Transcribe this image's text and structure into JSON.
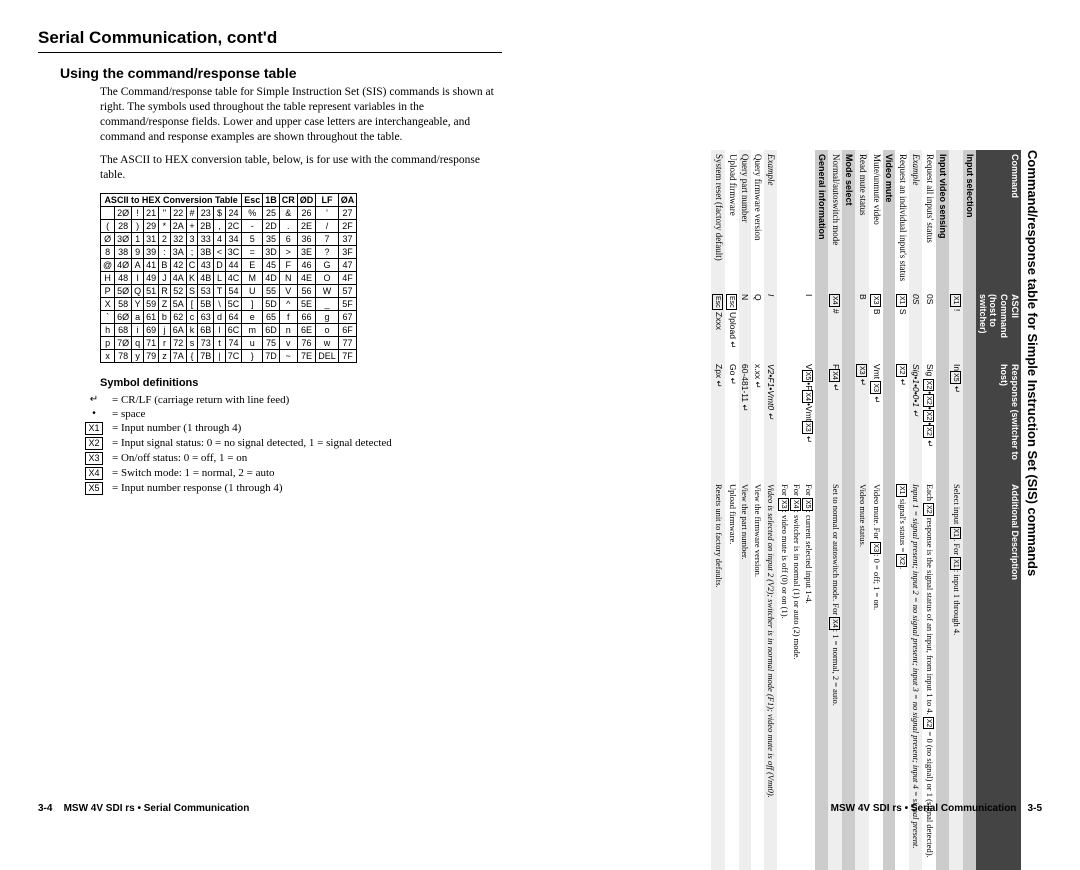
{
  "left": {
    "section_title": "Serial Communication, cont'd",
    "subheading": "Using the command/response table",
    "para1": "The Command/response table for Simple Instruction Set (SIS) commands is shown at right.  The symbols used throughout the table represent variables in the command/response fields.  Lower and upper case letters are interchangeable, and command and response examples are shown throughout the table.",
    "para2": "The ASCII to HEX conversion table, below, is for use with the command/response table.",
    "hex_title": "ASCII to HEX  Conversion Table",
    "hex_extra": [
      "Esc",
      "1B",
      "CR",
      "ØD",
      "LF",
      "ØA"
    ],
    "hex_rows": [
      [
        " ",
        "2Ø",
        "!",
        "21",
        "\"",
        "22",
        "#",
        "23",
        "$",
        "24",
        "%",
        "25",
        "&",
        "26",
        "'",
        "27"
      ],
      [
        "(",
        "28",
        ")",
        "29",
        "*",
        "2A",
        "+",
        "2B",
        ",",
        "2C",
        "-",
        "2D",
        ".",
        "2E",
        "/",
        "2F"
      ],
      [
        "Ø",
        "3Ø",
        "1",
        "31",
        "2",
        "32",
        "3",
        "33",
        "4",
        "34",
        "5",
        "35",
        "6",
        "36",
        "7",
        "37"
      ],
      [
        "8",
        "38",
        "9",
        "39",
        ":",
        "3A",
        ";",
        "3B",
        "<",
        "3C",
        "=",
        "3D",
        ">",
        "3E",
        "?",
        "3F"
      ],
      [
        "@",
        "4Ø",
        "A",
        "41",
        "B",
        "42",
        "C",
        "43",
        "D",
        "44",
        "E",
        "45",
        "F",
        "46",
        "G",
        "47"
      ],
      [
        "H",
        "48",
        "I",
        "49",
        "J",
        "4A",
        "K",
        "4B",
        "L",
        "4C",
        "M",
        "4D",
        "N",
        "4E",
        "O",
        "4F"
      ],
      [
        "P",
        "5Ø",
        "Q",
        "51",
        "R",
        "52",
        "S",
        "53",
        "T",
        "54",
        "U",
        "55",
        "V",
        "56",
        "W",
        "57"
      ],
      [
        "X",
        "58",
        "Y",
        "59",
        "Z",
        "5A",
        "[",
        "5B",
        "\\",
        "5C",
        "]",
        "5D",
        "^",
        "5E",
        "_",
        "5F"
      ],
      [
        "`",
        "6Ø",
        "a",
        "61",
        "b",
        "62",
        "c",
        "63",
        "d",
        "64",
        "e",
        "65",
        "f",
        "66",
        "g",
        "67"
      ],
      [
        "h",
        "68",
        "i",
        "69",
        "j",
        "6A",
        "k",
        "6B",
        "l",
        "6C",
        "m",
        "6D",
        "n",
        "6E",
        "o",
        "6F"
      ],
      [
        "p",
        "7Ø",
        "q",
        "71",
        "r",
        "72",
        "s",
        "73",
        "t",
        "74",
        "u",
        "75",
        "v",
        "76",
        "w",
        "77"
      ],
      [
        "x",
        "78",
        "y",
        "79",
        "z",
        "7A",
        "{",
        "7B",
        "|",
        "7C",
        "}",
        "7D",
        "~",
        "7E",
        "DEL",
        "7F"
      ]
    ],
    "sym_title": "Symbol definitions",
    "symbols": [
      {
        "k": "↵",
        "d": "= CR/LF (carriage return with line feed)"
      },
      {
        "k": "•",
        "d": "= space"
      },
      {
        "k": "X1",
        "d": "= Input number (1 through 4)",
        "box": true
      },
      {
        "k": "X2",
        "d": "= Input signal status: 0 = no signal detected, 1 = signal detected",
        "box": true
      },
      {
        "k": "X3",
        "d": "= On/off status: 0 = off, 1 = on",
        "box": true
      },
      {
        "k": "X4",
        "d": "= Switch mode: 1 = normal, 2 = auto",
        "box": true
      },
      {
        "k": "X5",
        "d": "= Input number response (1 through 4)",
        "box": true
      }
    ],
    "footer_num": "3-4",
    "footer_txt": "MSW 4V SDI rs • Serial Communication"
  },
  "right": {
    "caption": "Command/response table for Simple Instruction Set (SIS) commands",
    "head": [
      "Command",
      "ASCII Command (host to switcher)",
      "Response (switcher to host)",
      "Additional Description"
    ],
    "rows": [
      {
        "type": "group",
        "label": "Input selection"
      },
      {
        "type": "row",
        "shade": true,
        "c": "",
        "a": "[X1] !",
        "r": "In[X5] ↵",
        "d": "Select input [X1]. For [X1]: input 1 through 4."
      },
      {
        "type": "group",
        "label": "Input video sensing"
      },
      {
        "type": "row",
        "c": "Request all inputs' status",
        "a": "0S",
        "r": "Sig [X2]•[X2]•[X2]•[X2] ↵",
        "d": "Each [X2] response is the signal status of an input, from input 1 to 4. [X2] = 0 (no signal) or 1 (signal detected)."
      },
      {
        "type": "row",
        "shade": true,
        "ital": true,
        "c": "Example",
        "a": "0S",
        "r": "Sig•1•0•0•1 ↵",
        "d": "Input 1 = signal present; input 2 = no signal present; input 3 = no signal present; input 4 = signal present."
      },
      {
        "type": "row",
        "c": "Request an individual input's status",
        "a": "[X1] S",
        "r": "[X2] ↵",
        "d": "[X1] signal's status = [X2]."
      },
      {
        "type": "group",
        "label": "Video mute"
      },
      {
        "type": "row",
        "c": "Mute/unmute video",
        "a": "[X3] B",
        "r": "Vmt [X3] ↵",
        "d": "Video mute.  For [X3]: 0 = off; 1 = on."
      },
      {
        "type": "row",
        "shade": true,
        "c": "Read mute status",
        "a": "B",
        "r": "[X3] ↵",
        "d": "Video mute status."
      },
      {
        "type": "group",
        "label": "Mode select"
      },
      {
        "type": "row",
        "shade": true,
        "c": "Normal/autoswitch mode",
        "a": "[X4] #",
        "r": "F[X4] ↵",
        "d": "Set to normal or autoswitch mode. For [X4]: 1 = normal, 2 = auto."
      },
      {
        "type": "group",
        "label": "General information"
      },
      {
        "type": "row",
        "c": "",
        "a": "I",
        "r": "V[X5]•F[X4]•Vmt[X3] ↵",
        "d": "For [X5]: current selected input 1-4.\nFor [X4]: switcher is in normal (1) or auto (2) mode.\nFor [X3]: video mute is off (0) or on (1)."
      },
      {
        "type": "row",
        "shade": true,
        "ital": true,
        "c": "Example",
        "a": "I",
        "r": "V2•F1•Vmt0 ↵",
        "d": "Video is selected on input 2 (V2); switcher is in normal mode (F1); video mute is off (Vmt0)."
      },
      {
        "type": "row",
        "c": "Query firmware version",
        "a": "Q",
        "r": "x.xx ↵",
        "d": "View the firmware version."
      },
      {
        "type": "row",
        "shade": true,
        "c": "Query part number",
        "a": "N",
        "r": "60-481-11 ↵",
        "d": "View the part number."
      },
      {
        "type": "row",
        "c": "Upload firmware",
        "a": "[Esc] Upload ↵",
        "r": "Go ↵",
        "d": "Upload firmware."
      },
      {
        "type": "row",
        "shade": true,
        "c": "System reset (factory default)",
        "a": "[Esc] Zxxx",
        "r": "Zpx ↵",
        "d": "Resets unit to factory defaults."
      }
    ],
    "footer_txt": "MSW 4V SDI rs • Serial Communication",
    "footer_num": "3-5"
  }
}
